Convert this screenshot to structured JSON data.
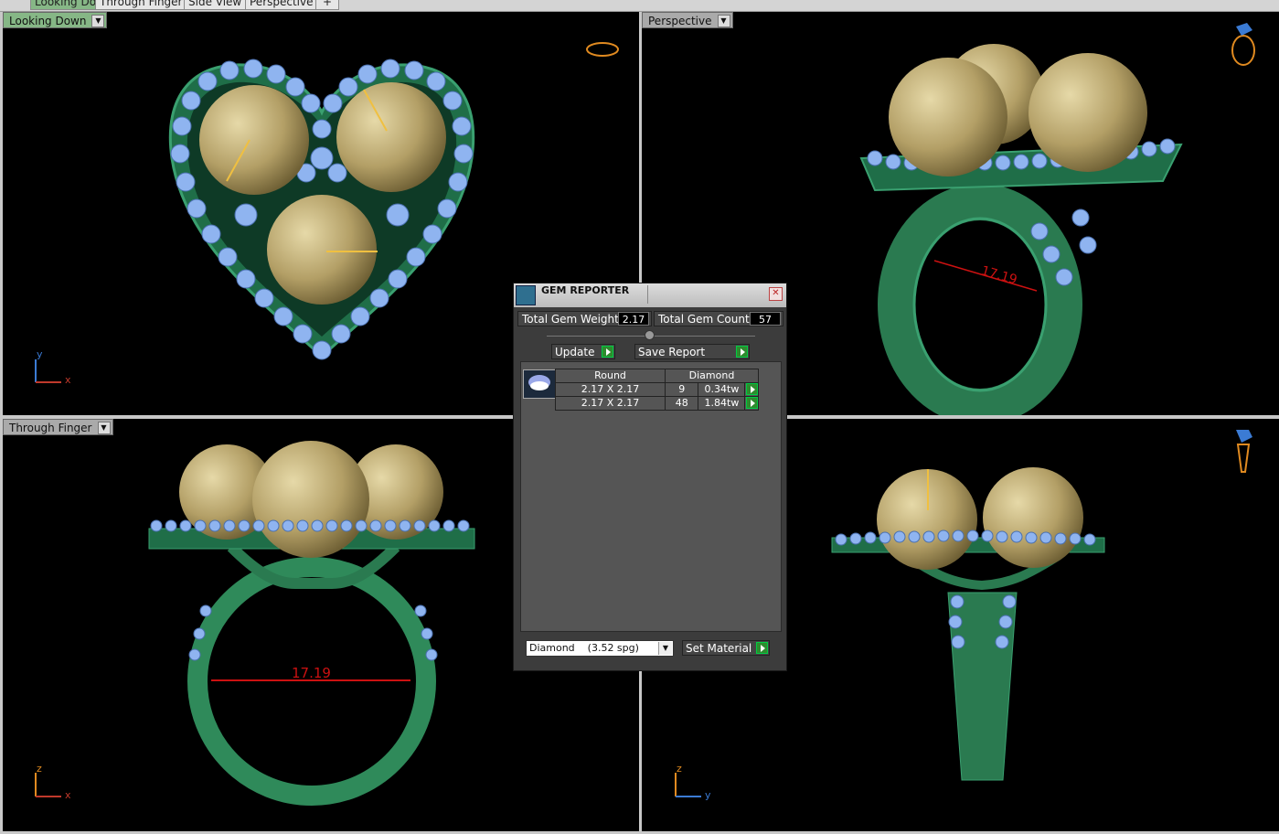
{
  "tabs": [
    {
      "label": "Looking Down",
      "active": true
    },
    {
      "label": "Through Finger",
      "active": false
    },
    {
      "label": "Side View",
      "active": false
    },
    {
      "label": "Perspective",
      "active": false
    },
    {
      "label": "+",
      "active": false
    }
  ],
  "viewports": {
    "top_left": {
      "label": "Looking Down",
      "axis_v": "y",
      "axis_h": "x"
    },
    "top_right": {
      "label": "Perspective",
      "dimension": "17.19"
    },
    "bottom_left": {
      "label": "Through Finger",
      "axis_v": "z",
      "axis_h": "x",
      "dimension": "17.19"
    },
    "bottom_right": {
      "label": "",
      "axis_v": "z",
      "axis_h": "y"
    }
  },
  "gem_reporter": {
    "title": "GEM REPORTER",
    "total_weight_label": "Total Gem Weight",
    "total_weight_value": "2.17",
    "total_count_label": "Total Gem Count",
    "total_count_value": "57",
    "update_label": "Update",
    "save_report_label": "Save Report",
    "table": {
      "headers": [
        "Round",
        "Diamond"
      ],
      "rows": [
        {
          "size": "2.17 X 2.17",
          "count": "9",
          "weight": "0.34tw"
        },
        {
          "size": "2.17 X 2.17",
          "count": "48",
          "weight": "1.84tw"
        }
      ]
    },
    "material_select": "Diamond    (3.52 spg)",
    "set_material_label": "Set Material"
  },
  "colors": {
    "metal": "#2f8a5a",
    "gem": "#8fb4f0",
    "pearl": "#b8a46a",
    "dimension": "#cc1111",
    "viewport_bg": "#000000"
  }
}
